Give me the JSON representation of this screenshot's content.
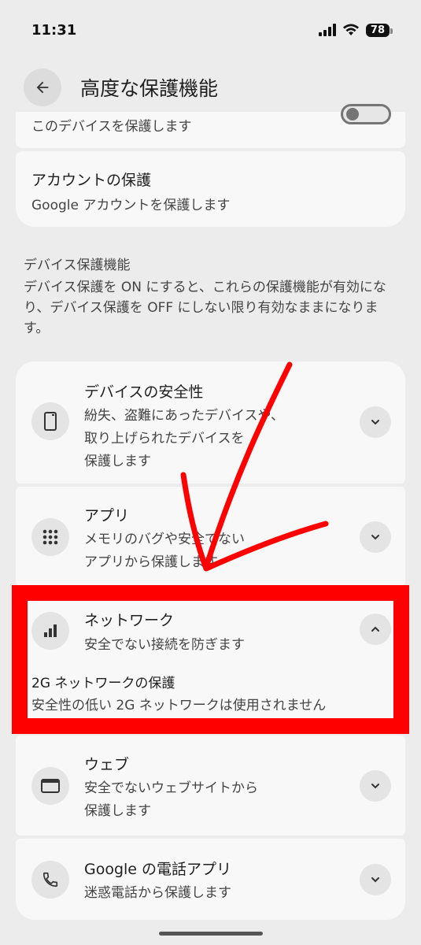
{
  "status_bar": {
    "time": "11:31",
    "battery": "78"
  },
  "app_bar": {
    "title": "高度な保護機能"
  },
  "top_card": {
    "subtitle": "このデバイスを保護します"
  },
  "account_card": {
    "title": "アカウントの保護",
    "subtitle": "Google アカウントを保護します"
  },
  "device_protection": {
    "heading": "デバイス保護機能",
    "description": "デバイス保護を ON にすると、これらの保護機能が有効になり、デバイス保護を OFF にしない限り有効なままになります。"
  },
  "features": {
    "device_safety": {
      "title": "デバイスの安全性",
      "line1": "紛失、盗難にあったデバイスや、",
      "line2": "取り上げられたデバイスを",
      "line3": "保護します",
      "icon": "phone-device-icon"
    },
    "apps": {
      "title": "アプリ",
      "line1": "メモリのバグや安全でない",
      "line2": "アプリから保護します",
      "icon": "apps-grid-icon"
    },
    "network": {
      "title": "ネットワーク",
      "line1": "安全でない接続を防ぎます",
      "icon": "signal-bars-icon",
      "expanded": true,
      "sub_title": "2G ネットワークの保護",
      "sub_desc": "安全性の低い 2G ネットワークは使用されません"
    },
    "web": {
      "title": "ウェブ",
      "line1": "安全でないウェブサイトから",
      "line2": "保護します",
      "icon": "browser-window-icon"
    },
    "phone_app": {
      "title": "Google の電話アプリ",
      "line1": "迷惑電話から保護します",
      "icon": "phone-call-icon"
    }
  },
  "colors": {
    "annotation": "#ff0000",
    "background": "#ececec",
    "card": "#f8f8f8"
  }
}
